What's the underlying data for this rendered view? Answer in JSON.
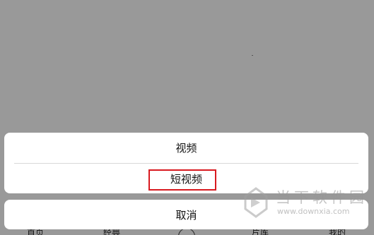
{
  "tabbar": {
    "items": [
      {
        "label": "首页"
      },
      {
        "label": "经典"
      },
      {
        "label": "片库"
      },
      {
        "label": "我的"
      }
    ]
  },
  "action_sheet": {
    "options": [
      {
        "label": "视频"
      },
      {
        "label": "短视频"
      }
    ],
    "cancel_label": "取消"
  },
  "highlight_color": "#d8191f",
  "watermark": {
    "title": "当下软件园",
    "url": "www.downxia.com"
  }
}
